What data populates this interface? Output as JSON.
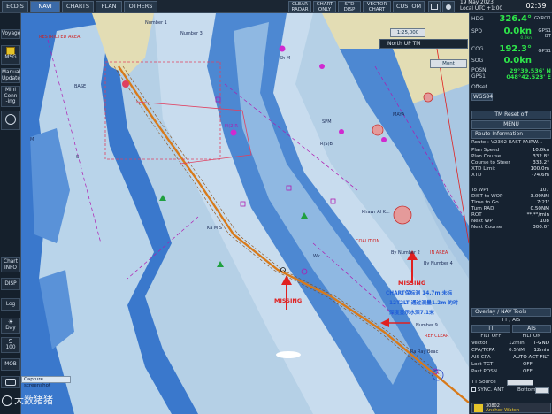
{
  "topbar": {
    "ecdis": "ECDIS",
    "navi": "NAVI",
    "charts": "CHARTS",
    "plan": "PLAN",
    "others": "OTHERS",
    "clear_radar_1": "CLEAR",
    "clear_radar_2": "RADAR",
    "chart_only_1": "CHART",
    "chart_only_2": "ONLY",
    "std_disp_1": "STD",
    "std_disp_2": "DISP",
    "vector_chart_1": "VECTOR",
    "vector_chart_2": "CHART",
    "custom": "CUSTOM",
    "date": "19 May 2023",
    "local_utc": "Local UTC +1:00",
    "clock": "02:39"
  },
  "leftbar": {
    "voyage": "Voyage",
    "msg": "MSG",
    "manual_update_1": "Manual",
    "manual_update_2": "Update",
    "mini_conning_1": "Mini",
    "mini_conning_2": "Conn",
    "mini_conning_3": "-ing",
    "chart_info_1": "Chart",
    "chart_info_2": "INFO",
    "disp": "DISP",
    "log": "Log",
    "s_day": "Day",
    "s100": "100",
    "mob": "MOB"
  },
  "chart_overlay": {
    "range": "1:25,000",
    "north_up": "North UP TM",
    "mont": "Mont"
  },
  "chart_labels": {
    "l1": "Number 1",
    "l2": "Number 3",
    "l3": "RESTRICTED AREA",
    "l4": "BASE",
    "l5": "Sh M",
    "l6": "M",
    "l7": "S",
    "l8": "Fl(2)R",
    "l9": "R(S)B",
    "l10": "SPM",
    "l11": "Khawr Al K...",
    "l12": "MAYA",
    "l13": "COALITION",
    "l14": "By Number 2",
    "l15": "By Number 4",
    "l16": "IN AREA",
    "l17": "Ka M S",
    "l18": "Wk",
    "l19": "Ra Ray Beac",
    "l20": "Number 9",
    "l21": "REF CLEAR"
  },
  "annotations": {
    "missing_1": "MISSING",
    "missing_2": "MISSING",
    "chart_note_1": "CHART保标测 14.7m 未标",
    "chart_note_2": "12T2LT 通过测量1.2m 的时",
    "chart_note_3": "深度显示水深7.1米",
    "capture": "Capture screenshot",
    "watermark": "大数猪猪"
  },
  "nav": {
    "hdg_label": "HDG",
    "hdg_value": "326.4°",
    "hdg_src": "GYRO1",
    "spd_label": "SPD",
    "spd_value": "0.0kn",
    "spd_sub": "0.0kn",
    "spd_src_1": "GPS1",
    "spd_src_2": "BT",
    "cog_label": "COG",
    "cog_value": "192.3°",
    "sog_label": "SOG",
    "sog_value": "0.0kn",
    "sog_src": "GPS1",
    "posn_label": "POSN",
    "posn_src": "GPS1",
    "lat": "29°39.536' N",
    "lon": "048°42.523' E",
    "offset": "Offset",
    "datum": "WGS84",
    "tm_reset": "TM Reset off",
    "menu": "MENU"
  },
  "route_info": {
    "header": "Route Information",
    "route": "Route :",
    "route_name": "V2302 EAST FAIRW...",
    "plan_speed": "Plan Speed",
    "plan_speed_v": "10.0kn",
    "plan_course": "Plan Course",
    "plan_course_v": "332.8°",
    "course_to_steer": "Course to Steer",
    "course_to_steer_v": "333.2°",
    "xtd_limit": "XTD Limit",
    "xtd_limit_v": "100.0m",
    "xtd": "XTD",
    "xtd_v": "-74.6m",
    "to_wpt": "To WPT",
    "to_wpt_v": "107",
    "dist_to_wop": "DIST to WOP",
    "dist_to_wop_v": "3.09NM",
    "time_to_go": "Time to Go",
    "time_to_go_v": "7:21'",
    "turn_rad": "Turn RAD",
    "turn_rad_v": "0.50NM",
    "rot": "ROT",
    "rot_v": "**.*°/min",
    "next_wpt": "Next WPT",
    "next_wpt_v": "108",
    "next_course": "Next Course",
    "next_course_v": "300.0°"
  },
  "overlay_nav": {
    "header": "Overlay / NAV Tools",
    "tt": "TT",
    "ais": "AIS",
    "ais_label": "TT / AIS",
    "filt_off": "FILT OFF",
    "filt_on": "FILT ON",
    "vector": "Vector",
    "vector_v": "12min",
    "vector_v2": "T-GND",
    "cpa_tcpa": "CPA/TCPA",
    "cpa_v": "0.5NM",
    "cpa_v2": "12min",
    "ais_cpa": "AIS CPA",
    "ais_cpa_v": "AUTO ACT FILT",
    "lost_tgt": "Lost TGT",
    "lost_tgt_v": "OFF",
    "past_posn": "Past POSN",
    "past_posn_v": "OFF",
    "tt_source": "TT Source",
    "sync_ant": "SYNC. ANT",
    "bottom": "Bottom"
  },
  "alert": {
    "code": "30802",
    "text": "Anchor Watch"
  },
  "colors": {
    "deep_water": "#b5d0e6",
    "shallow_water": "#3a78cc",
    "land": "#e3ddb4",
    "route": "#d87a1a",
    "speed_green": "#2ee64a",
    "accent_blue": "#3b6aa8",
    "annotation_red": "#e02020"
  }
}
